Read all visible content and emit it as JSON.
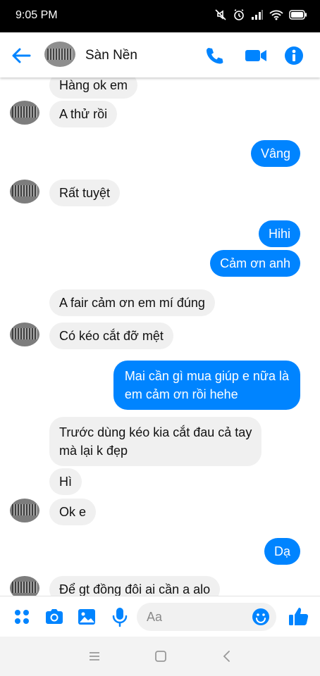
{
  "status": {
    "time": "9:05 PM"
  },
  "header": {
    "title": "Sàn Nền"
  },
  "messages": [
    {
      "side": "in",
      "text": "Hàng ok em"
    },
    {
      "side": "in",
      "text": "A thử rồi"
    },
    {
      "side": "out",
      "text": "Vâng"
    },
    {
      "side": "in",
      "text": "Rất tuyệt"
    },
    {
      "side": "out",
      "text": "Hihi"
    },
    {
      "side": "out",
      "text": "Cảm ơn anh"
    },
    {
      "side": "in",
      "text": "A fair cảm ơn em mí đúng"
    },
    {
      "side": "in",
      "text": "Có kéo cắt đỡ mệt"
    },
    {
      "side": "out",
      "text": "Mai cần gì mua giúp e nữa là\nem cảm ơn rồi hehe"
    },
    {
      "side": "in",
      "text": "Trước dùng kéo kia cắt đau cả tay\nmà lại k đẹp"
    },
    {
      "side": "in",
      "text": "Hì"
    },
    {
      "side": "in",
      "text": "Ok e"
    },
    {
      "side": "out",
      "text": "Dạ"
    },
    {
      "side": "in",
      "text": "Để gt đồng đôi ai cần a alo"
    }
  ],
  "composer": {
    "placeholder": "Aa"
  },
  "icons": {
    "back": "arrow-left-icon",
    "call": "phone-icon",
    "video": "video-camera-icon",
    "info": "info-icon",
    "apps": "four-dots-icon",
    "camera": "camera-icon",
    "gallery": "image-icon",
    "mic": "microphone-icon",
    "emoji": "smiley-icon",
    "like": "thumbs-up-icon"
  },
  "colors": {
    "accent": "#0084ff",
    "incoming_bubble": "#f0f0f0"
  }
}
